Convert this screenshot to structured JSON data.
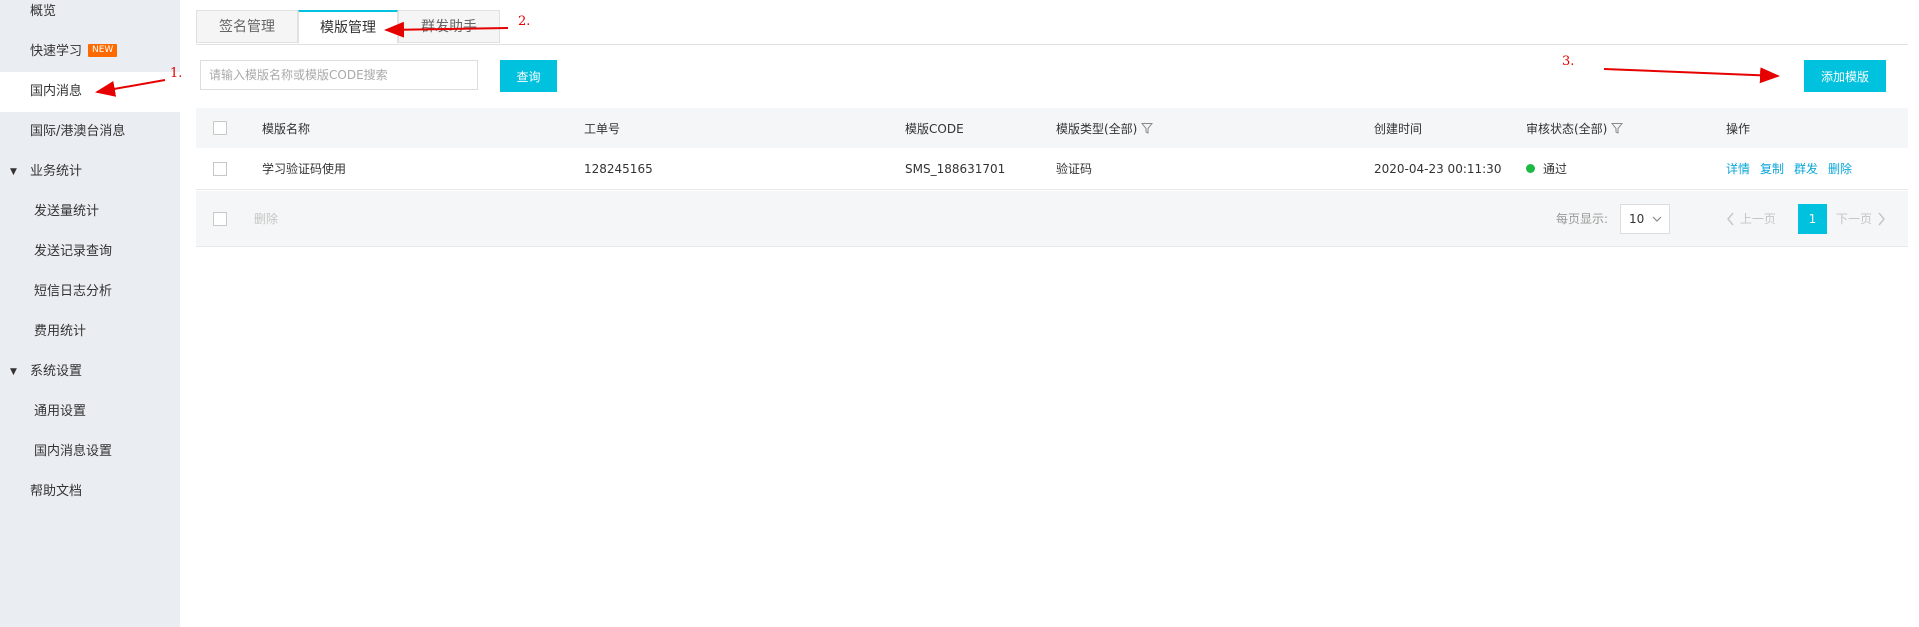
{
  "sidebar": {
    "items": [
      {
        "label": "概览"
      },
      {
        "label": "快速学习",
        "badge": "NEW"
      },
      {
        "label": "国内消息"
      },
      {
        "label": "国际/港澳台消息"
      },
      {
        "label": "业务统计"
      },
      {
        "label": "发送量统计"
      },
      {
        "label": "发送记录查询"
      },
      {
        "label": "短信日志分析"
      },
      {
        "label": "费用统计"
      },
      {
        "label": "系统设置"
      },
      {
        "label": "通用设置"
      },
      {
        "label": "国内消息设置"
      },
      {
        "label": "帮助文档"
      }
    ]
  },
  "tabs": [
    {
      "label": "签名管理"
    },
    {
      "label": "模版管理"
    },
    {
      "label": "群发助手"
    }
  ],
  "search": {
    "placeholder": "请输入模版名称或模版CODE搜索",
    "query_label": "查询"
  },
  "add_button_label": "添加模版",
  "table": {
    "columns": [
      "模版名称",
      "工单号",
      "模版CODE",
      "模版类型(全部)",
      "创建时间",
      "审核状态(全部)",
      "操作"
    ],
    "rows": [
      {
        "name": "学习验证码使用",
        "ticket": "128245165",
        "code": "SMS_188631701",
        "type": "验证码",
        "created": "2020-04-23 00:11:30",
        "status": "通过",
        "actions": [
          "详情",
          "复制",
          "群发",
          "删除"
        ]
      }
    ]
  },
  "footer": {
    "delete_label": "删除",
    "page_size_label": "每页显示:",
    "page_size": "10",
    "prev_label": "上一页",
    "current_page": "1",
    "next_label": "下一页"
  },
  "annotations": [
    "1.",
    "2.",
    "3."
  ],
  "colors": {
    "accent": "#00c1de",
    "annotation": "#e60000",
    "status_ok": "#1db944",
    "link": "#0aa6d8",
    "badge": "#ff6a00"
  }
}
